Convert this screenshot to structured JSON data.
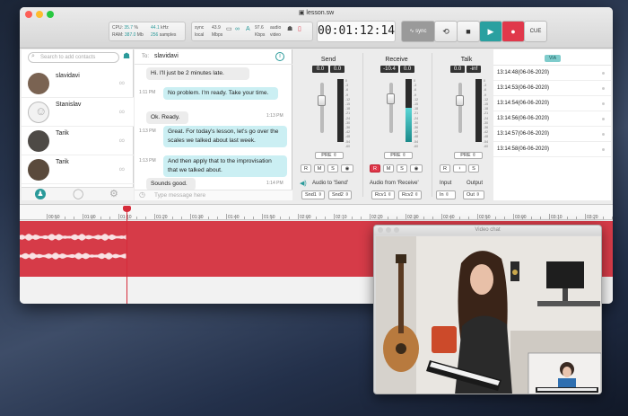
{
  "window": {
    "title": "lesson.sw"
  },
  "stats": {
    "cpu_label": "CPU:",
    "cpu_value": "35.7",
    "cpu_unit": "%",
    "ram_label": "RAM:",
    "ram_value": "387.0",
    "ram_unit": "Mb",
    "khz_value": "44.1",
    "khz_unit": "kHz",
    "samples_value": "256",
    "samples_unit": "samples"
  },
  "sync_group": {
    "sync": "sync",
    "local": "local",
    "khz": "43.9",
    "mbps": "Mbps",
    "link": "97.6",
    "kbps": "Kbps",
    "audio": "audio",
    "video": "video"
  },
  "timecode": "00:01:12:14",
  "transport": {
    "sync_label": "sync",
    "cue_label": "CUE"
  },
  "contacts": {
    "search_placeholder": "Search to add contacts",
    "items": [
      {
        "name": "slavidavi"
      },
      {
        "name": "Stanislav"
      },
      {
        "name": "Tarik"
      },
      {
        "name": "Tarik"
      }
    ]
  },
  "chat": {
    "to_label": "To:",
    "to_name": "slavidavi",
    "input_placeholder": "Type message here",
    "messages": [
      {
        "side": "in",
        "text": "Hi. I'll just be 2 minutes late.",
        "time": ""
      },
      {
        "side": "out",
        "text": "No problem. I'm ready. Take your time.",
        "time": "1:11 PM"
      },
      {
        "side": "in",
        "text": "Ok. Ready.",
        "time": "1:13 PM"
      },
      {
        "side": "out",
        "text": "Great. For today's lesson, let's go over the scales we talked about last week.",
        "time": "1:13 PM"
      },
      {
        "side": "out",
        "text": "And then apply that to the improvisation that we talked about.",
        "time": "1:13 PM"
      },
      {
        "side": "in",
        "text": "Sounds good.",
        "time": "1:14 PM"
      }
    ]
  },
  "mixer": {
    "channels": [
      {
        "label": "Send",
        "db1": "0.0",
        "db2": "0.0",
        "level": 0.0
      },
      {
        "label": "Receive",
        "db1": "-10.4",
        "db2": "0.0",
        "level": 0.55
      },
      {
        "label": "Talk",
        "db1": "0.0",
        "db2": "-inf",
        "level": 0.0
      }
    ],
    "pre": "PRE",
    "r": "R",
    "m": "M",
    "s": "S",
    "audio_to_send": "Audio to 'Send'",
    "audio_from_receive": "Audio from 'Receive'",
    "input": "Input",
    "output": "Output",
    "dropdowns": [
      "Snd1",
      "Snd2",
      "Rcv1",
      "Rcv2",
      "In",
      "Out"
    ],
    "scale": [
      "0",
      "-3",
      "-6",
      "-9",
      "-12",
      "-15",
      "-18",
      "-21",
      "-24",
      "-30",
      "-36",
      "-42",
      "-48",
      "-54",
      "-60"
    ]
  },
  "log": {
    "badge": "VIA",
    "entries": [
      "13:14:48(06-06-2020)",
      "13:14:53(06-06-2020)",
      "13:14:54(06-06-2020)",
      "13:14:56(06-06-2020)",
      "13:14:57(06-06-2020)",
      "13:14:58(06-06-2020)"
    ]
  },
  "ruler": {
    "ticks": [
      "00:50",
      "01:00",
      "01:10",
      "01:20",
      "01:30",
      "01:40",
      "01:50",
      "02:00",
      "02:10",
      "02:20",
      "02:30",
      "02:40",
      "02:50",
      "03:00",
      "03:10",
      "03:20"
    ]
  },
  "video": {
    "title": "Video chat"
  },
  "colors": {
    "accent": "#2a9a9a",
    "record": "#e0384b",
    "track": "#d63b48"
  }
}
